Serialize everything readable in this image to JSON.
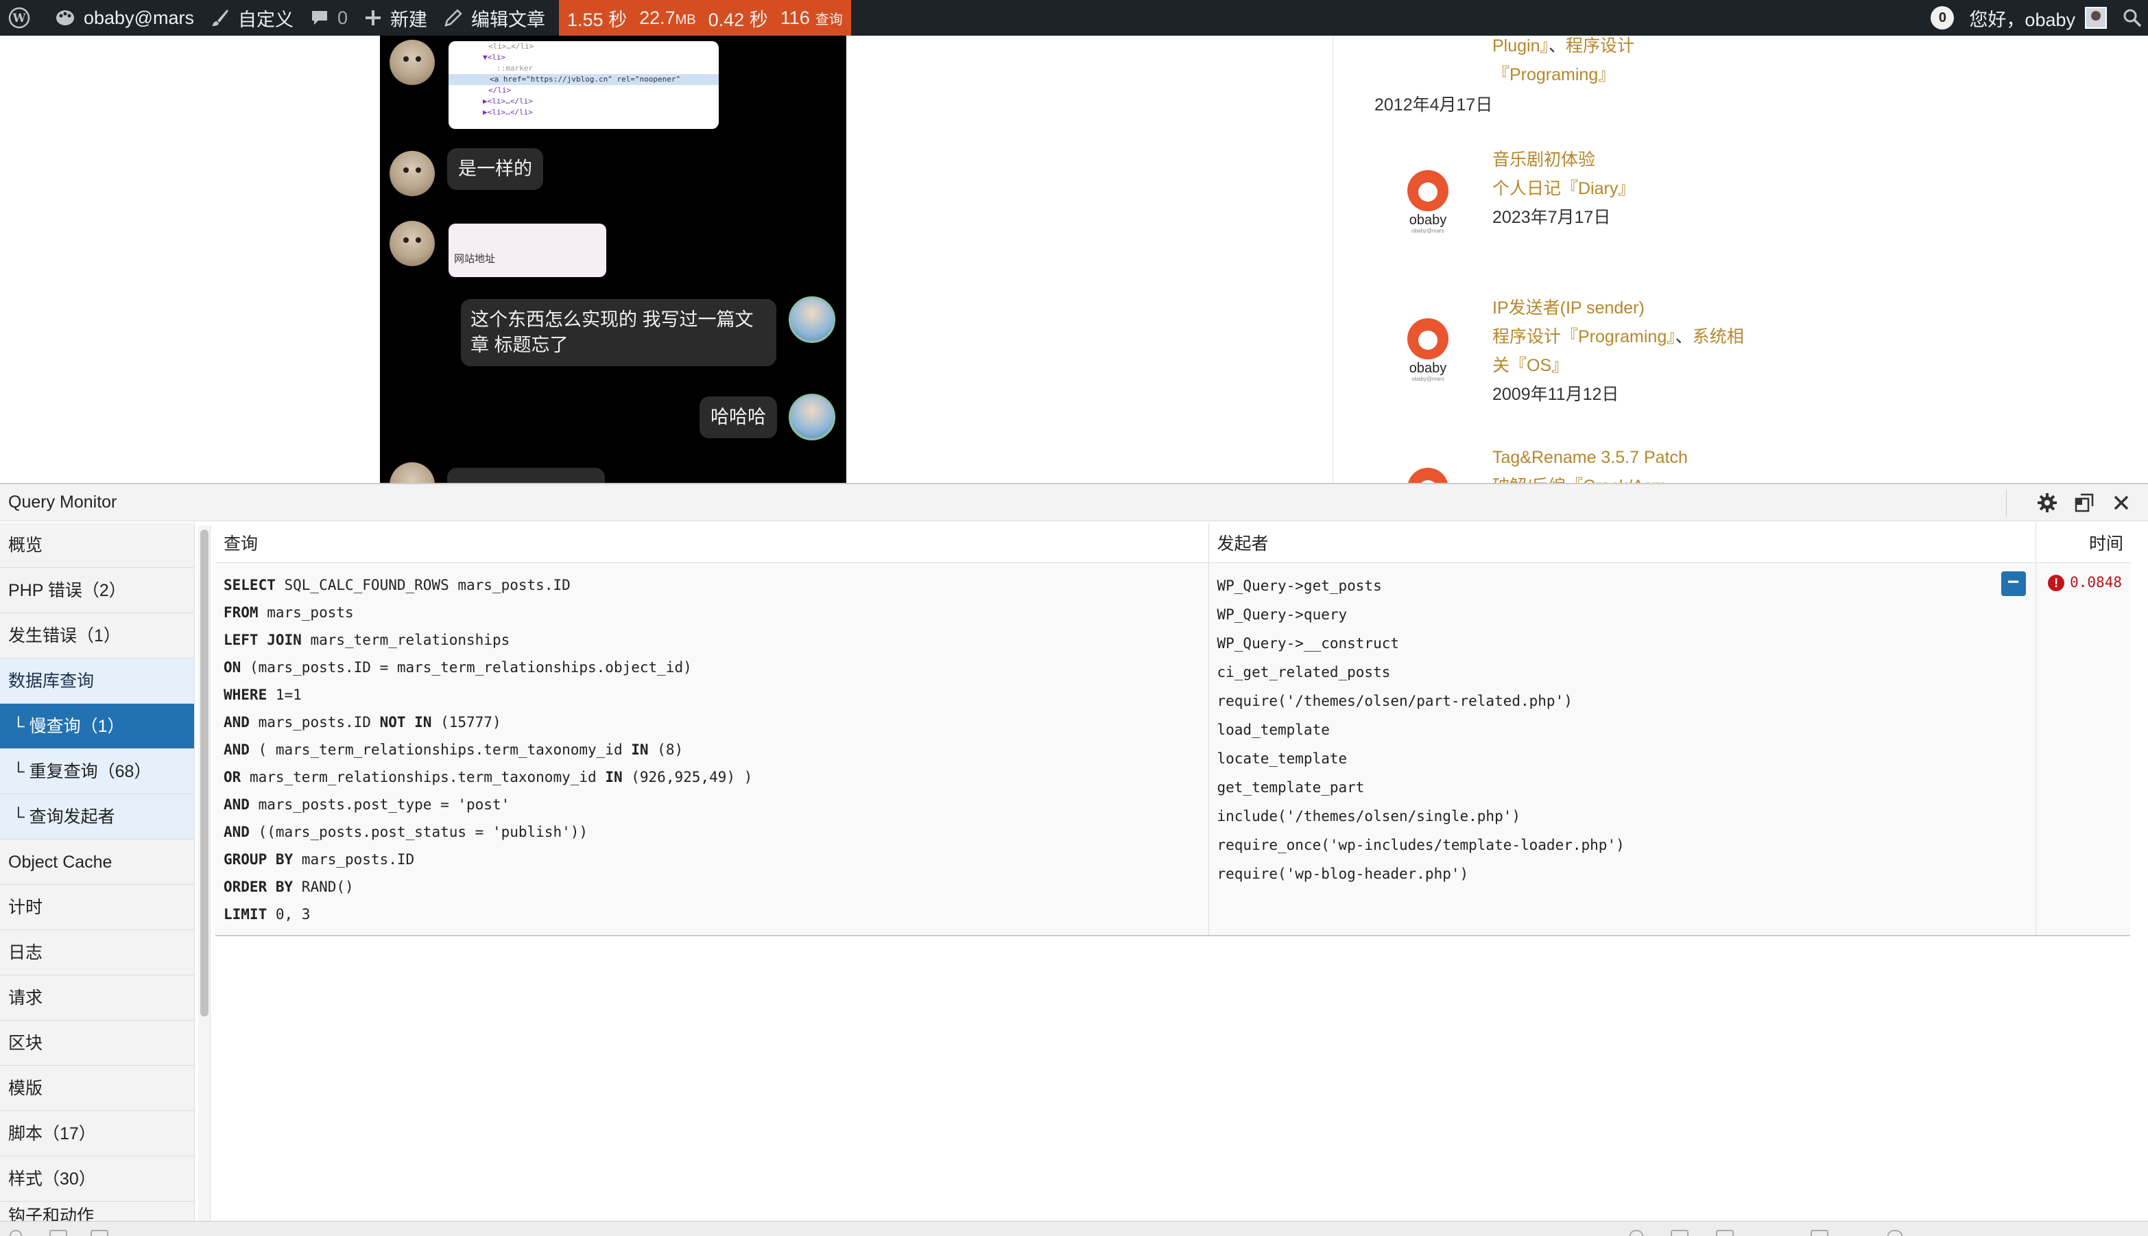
{
  "admin_bar": {
    "site": "obaby@mars",
    "customize": "自定义",
    "comments_count": "0",
    "new": "新建",
    "edit": "编辑文章",
    "qm": {
      "time": "1.55 秒",
      "memory_value": "22.7",
      "memory_unit": "MB",
      "db_time": "0.42 秒",
      "queries": "116",
      "queries_label": "查询"
    },
    "notifications": "0",
    "greeting": "您好，obaby"
  },
  "chat": {
    "code_lines": [
      "<li>…</li>",
      "▼<li>",
      "::marker",
      "<a href=\"https://jvblog.cn\" rel=\"noopener\"",
      "</li>",
      "▶<li>…</li>",
      "▶<li>…</li>"
    ],
    "msg1": "是一样的",
    "card_text": "网站地址",
    "msg2": "这个东西怎么实现的 我写过一篇文章 标题忘了",
    "msg3": "哈哈哈"
  },
  "related": {
    "top_cats": "Plugin』、程序设计『Programing』",
    "top_cats_a": "Plugin』",
    "top_cats_sep": "、",
    "top_cats_b": "程序设计",
    "top_cats_c": "『Programing』",
    "top_date": "2012年4月17日",
    "items": [
      {
        "title": "音乐剧初体验",
        "cat": "个人日记『Diary』",
        "date": "2023年7月17日"
      },
      {
        "title": "IP发送者(IP sender)",
        "cat1": "程序设计『Programing』",
        "sep": "、",
        "cat2": "系统相",
        "cat3": "关『OS』",
        "date": "2009年11月12日"
      },
      {
        "title": "Tag&Rename 3.5.7 Patch",
        "cat": "破解/反编『Crack/Asm"
      }
    ],
    "logo_text": "obaby",
    "logo_sub": "obaby@mars"
  },
  "qm": {
    "title": "Query Monitor",
    "nav": [
      {
        "label": "概览"
      },
      {
        "label": "PHP 错误（2）"
      },
      {
        "label": "发生错误（1）"
      },
      {
        "label": "数据库查询"
      },
      {
        "label": "└ 慢查询（1）"
      },
      {
        "label": "└ 重复查询（68）"
      },
      {
        "label": "└ 查询发起者"
      },
      {
        "label": "Object Cache"
      },
      {
        "label": "计时"
      },
      {
        "label": "日志"
      },
      {
        "label": "请求"
      },
      {
        "label": "区块"
      },
      {
        "label": "模版"
      },
      {
        "label": "脚本（17）"
      },
      {
        "label": "样式（30）"
      },
      {
        "label": "钩子和动作"
      }
    ],
    "columns": {
      "query": "查询",
      "caller": "发起者",
      "time": "时间"
    },
    "row": {
      "sql": [
        {
          "kw": "SELECT",
          "rest": " SQL_CALC_FOUND_ROWS mars_posts.ID"
        },
        {
          "kw": "FROM",
          "rest": " mars_posts"
        },
        {
          "kw": "LEFT JOIN",
          "rest": " mars_term_relationships"
        },
        {
          "kw": "ON",
          "rest": " (mars_posts.ID = mars_term_relationships.object_id)"
        },
        {
          "kw": "WHERE",
          "rest": " 1=1"
        },
        {
          "kw": "AND",
          "rest": " mars_posts.ID ",
          "kw2": "NOT IN",
          "rest2": " (15777)"
        },
        {
          "kw": "AND",
          "rest": " ( mars_term_relationships.term_taxonomy_id ",
          "kw2": "IN",
          "rest2": " (8)"
        },
        {
          "kw": "OR",
          "rest": " mars_term_relationships.term_taxonomy_id ",
          "kw2": "IN",
          "rest2": " (926,925,49) )"
        },
        {
          "kw": "AND",
          "rest": " mars_posts.post_type = 'post'"
        },
        {
          "kw": "AND",
          "rest": " ((mars_posts.post_status = 'publish'))"
        },
        {
          "kw": "GROUP BY",
          "rest": " mars_posts.ID"
        },
        {
          "kw": "ORDER BY",
          "rest": " RAND()"
        },
        {
          "kw": "LIMIT",
          "rest": " 0, 3"
        }
      ],
      "callers": [
        "WP_Query->get_posts",
        "WP_Query->query",
        "WP_Query->__construct",
        "ci_get_related_posts",
        "require('/themes/olsen/part-related.php')",
        "load_template",
        "locate_template",
        "get_template_part",
        "include('/themes/olsen/single.php')",
        "require_once('wp-includes/template-loader.php')",
        "require('wp-blog-header.php')"
      ],
      "toggle": "−",
      "time": "0.0848",
      "warn": "!"
    }
  },
  "colors": {
    "admin_bar": "#1d2327",
    "qm_stats": "#d54e21",
    "active_nav": "#2271b1",
    "slow_time_bg": "#fbd9d9",
    "link_gold": "#b5872b"
  }
}
